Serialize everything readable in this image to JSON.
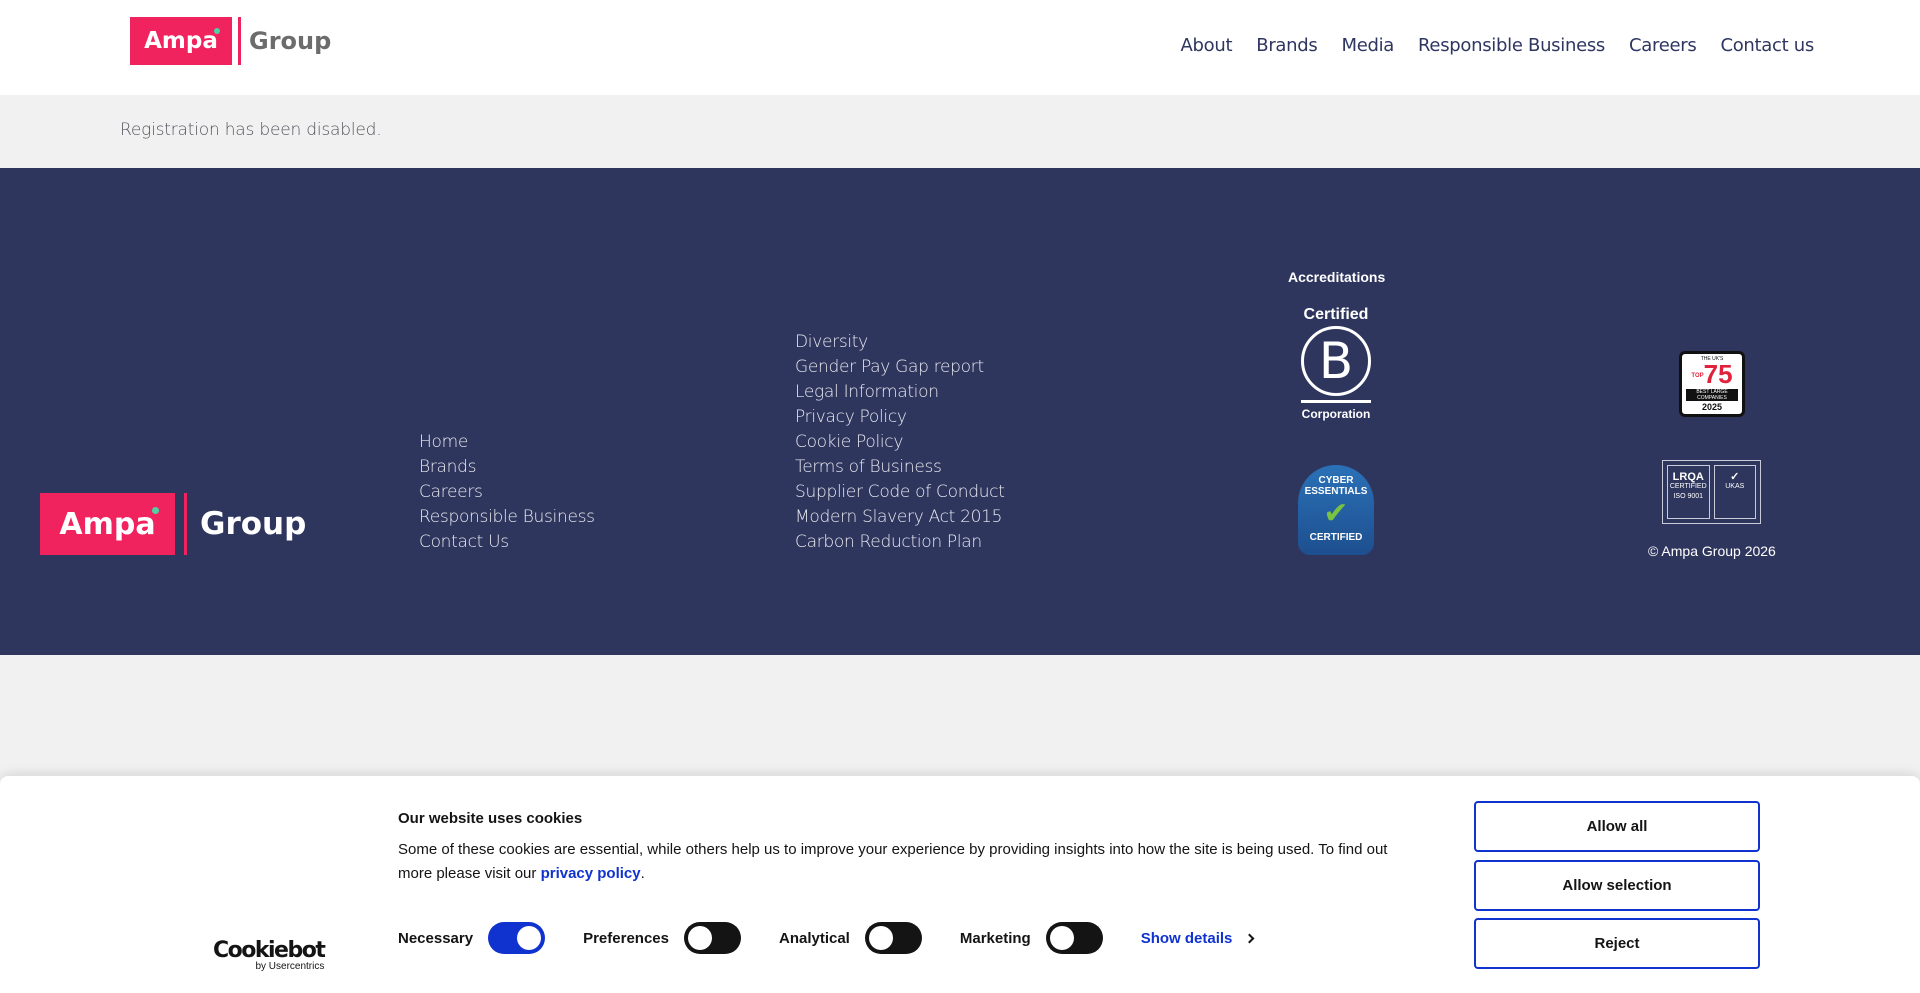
{
  "header": {
    "logo_brand": "Ampa",
    "logo_group": "Group",
    "nav": [
      "About",
      "Brands",
      "Media",
      "Responsible Business",
      "Careers",
      "Contact us"
    ]
  },
  "main": {
    "message": "Registration has been disabled."
  },
  "footer": {
    "logo_brand": "Ampa",
    "logo_group": "Group",
    "links_col1": [
      "Home",
      "Brands",
      "Careers",
      "Responsible Business",
      "Contact Us"
    ],
    "links_col2": [
      "Diversity",
      "Gender Pay Gap report",
      "Legal Information",
      "Privacy Policy",
      "Cookie Policy",
      "Terms of Business",
      "Supplier Code of Conduct",
      "Modern Slavery Act 2015",
      "Carbon Reduction Plan"
    ],
    "accreditations_title": "Accreditations",
    "bcorp": {
      "top": "Certified",
      "letter": "B",
      "bottom": "Corporation"
    },
    "cyber": {
      "line1": "CYBER",
      "line2": "ESSENTIALS",
      "bottom": "CERTIFIED"
    },
    "top75": {
      "label": "THE UK'S",
      "top": "TOP",
      "number": "75",
      "band": "BEST LARGE COMPANIES",
      "year": "2025"
    },
    "lrqa": {
      "name": "LRQA",
      "certified": "CERTIFIED",
      "iso": "ISO 9001",
      "ukas": "UKAS"
    },
    "copyright": "© Ampa Group 2026"
  },
  "cookie_banner": {
    "brand": "Cookiebot",
    "brand_sub": "by Usercentrics",
    "title": "Our website uses cookies",
    "text": "Some of these cookies are essential, while others help us to improve your experience by providing insights into how the site is being used. To find out more please visit our ",
    "link": "privacy policy",
    "text_end": ".",
    "toggles": [
      {
        "label": "Necessary",
        "on": true
      },
      {
        "label": "Preferences",
        "on": false
      },
      {
        "label": "Analytical",
        "on": false
      },
      {
        "label": "Marketing",
        "on": false
      }
    ],
    "show_details": "Show details",
    "buttons": {
      "allow_all": "Allow all",
      "allow_selection": "Allow selection",
      "reject": "Reject"
    },
    "colors": {
      "accent": "#1032cf",
      "brand": "#f0235f",
      "footer": "#2f365e"
    }
  }
}
